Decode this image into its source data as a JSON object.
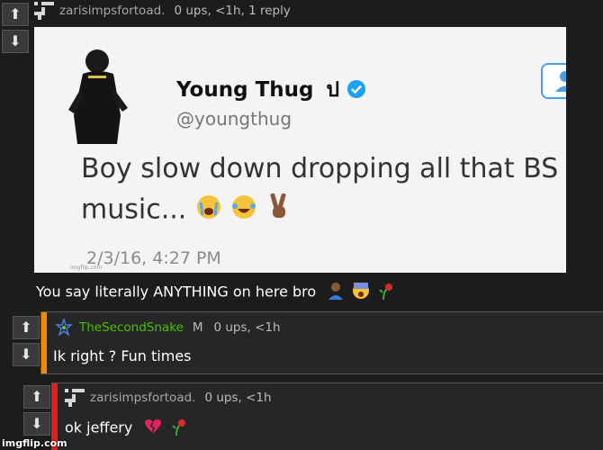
{
  "comment1": {
    "username": "zarisimpsfortoad.",
    "stats": "0 ups, <1h, 1 reply",
    "body": "You say literally ANYTHING on here bro",
    "tweet": {
      "name": "Young Thug",
      "name_glyph": "ป",
      "handle": "@youngthug",
      "text_line1": "Boy slow down dropping all that BS",
      "text_line2": "music...",
      "date": "2/3/16, 4:27 PM",
      "watermark": "imgflip.com"
    }
  },
  "comment2": {
    "username": "TheSecondSnake",
    "badge": "M",
    "stats": "0 ups, <1h",
    "body": "Ik right ? Fun times",
    "bar_color": "#f08a00"
  },
  "comment3": {
    "username": "zarisimpsfortoad.",
    "stats": "0 ups, <1h",
    "body": "ok jeffery",
    "bar_color": "#e02020"
  },
  "vote": {
    "up": "⬆",
    "down": "⬇"
  },
  "watermark": "imgflip.com",
  "colors": {
    "accent_green": "#48c000",
    "twitter_blue": "#1da1f2"
  }
}
